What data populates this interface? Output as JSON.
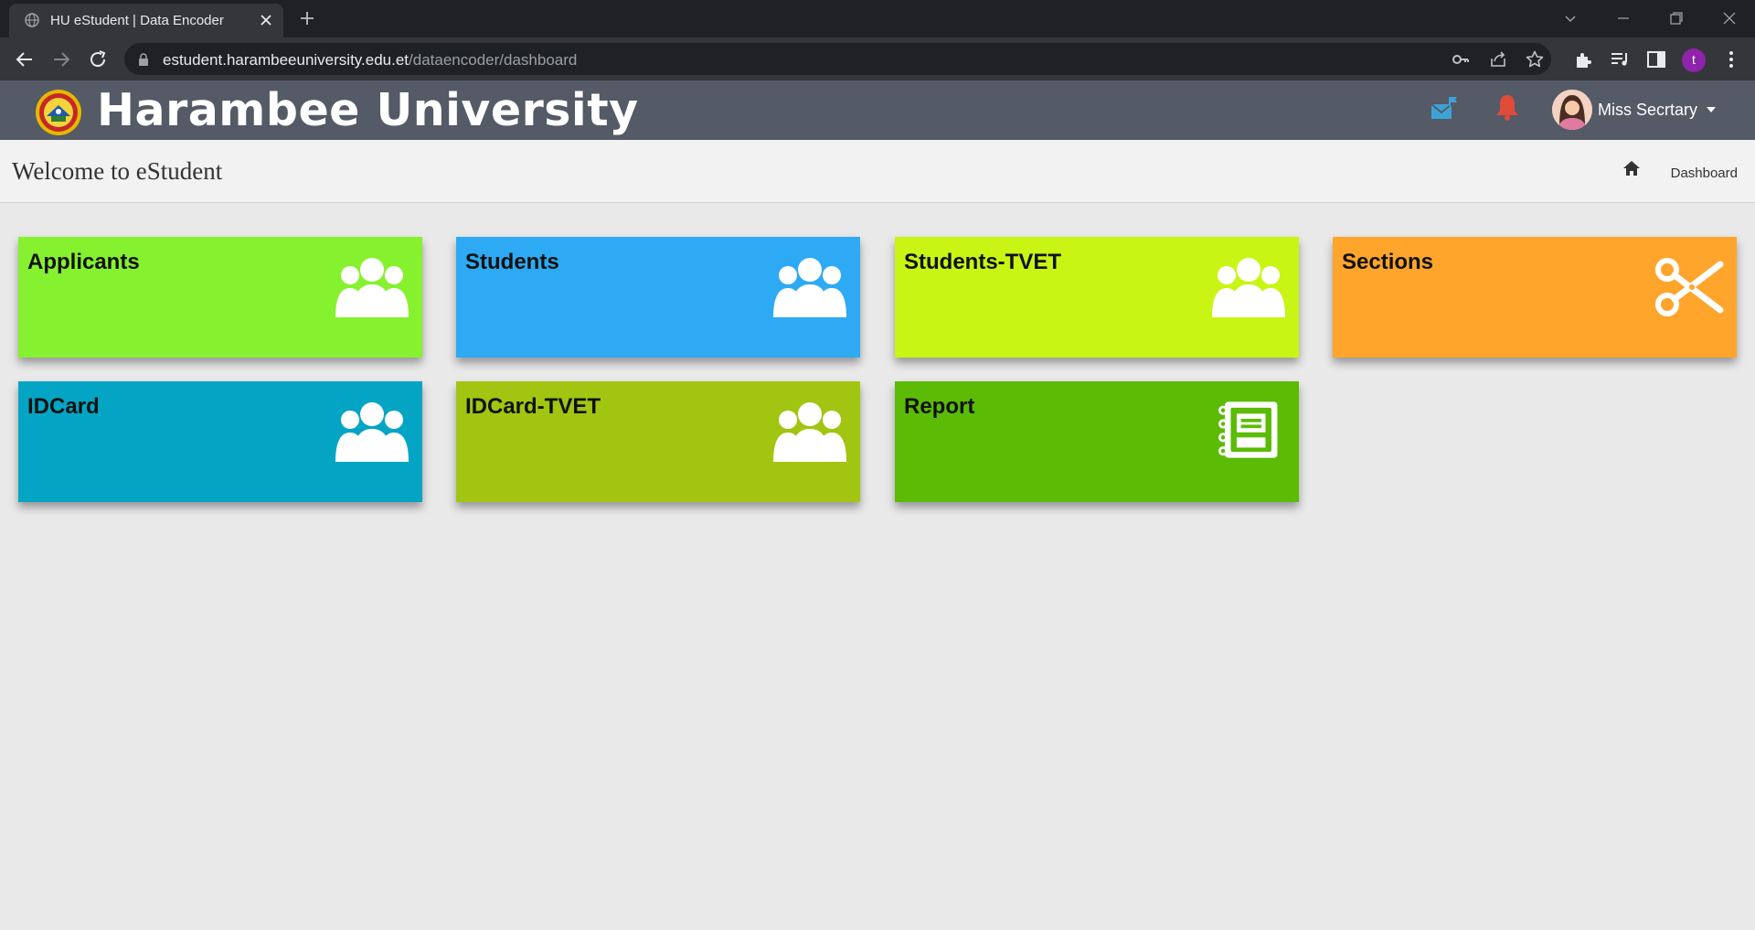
{
  "browser": {
    "tab_title": "HU eStudent | Data Encoder",
    "url_host": "estudent.harambeeuniversity.edu.et",
    "url_path": "/dataencoder/dashboard",
    "profile_initial": "t"
  },
  "header": {
    "brand": "Harambee University",
    "user_name": "Miss Secrtary",
    "colors": {
      "bar": "#545a66",
      "mail": "#3fa2d6",
      "bell": "#e04b3a"
    }
  },
  "page": {
    "title": "Welcome to eStudent",
    "breadcrumb": "Dashboard"
  },
  "tiles": [
    {
      "label": "Applicants",
      "color": "#86f12f",
      "icon": "users-icon"
    },
    {
      "label": "Students",
      "color": "#2daaf3",
      "icon": "users-icon"
    },
    {
      "label": "Students-TVET",
      "color": "#c8f514",
      "icon": "users-icon"
    },
    {
      "label": "Sections",
      "color": "#ffa52b",
      "icon": "scissors-icon"
    },
    {
      "label": "IDCard",
      "color": "#04a5c4",
      "icon": "users-icon"
    },
    {
      "label": "IDCard-TVET",
      "color": "#a2c512",
      "icon": "users-icon"
    },
    {
      "label": "Report",
      "color": "#5bbb05",
      "icon": "notebook-icon"
    }
  ]
}
